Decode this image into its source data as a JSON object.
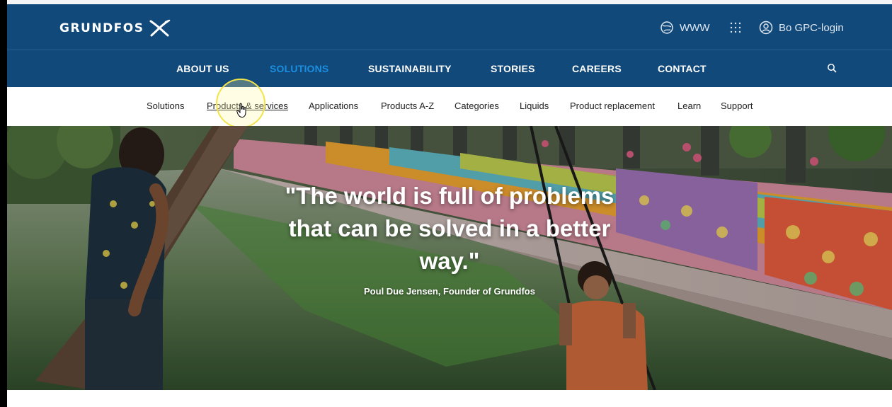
{
  "brand": {
    "name": "GRUNDFOS",
    "logo_icon": "grundfos-x-mark"
  },
  "utility": {
    "www_label": "WWW",
    "login_label": "Bo GPC-login",
    "icons": [
      "globe-icon",
      "apps-grid-icon",
      "user-icon"
    ]
  },
  "main_nav": {
    "items": [
      {
        "label": "ABOUT US"
      },
      {
        "label": "SOLUTIONS",
        "active": true
      },
      {
        "label": "SUSTAINABILITY"
      },
      {
        "label": "STORIES"
      },
      {
        "label": "CAREERS"
      },
      {
        "label": "CONTACT"
      }
    ],
    "search_icon": "search-icon"
  },
  "sub_nav": {
    "items": [
      {
        "label": "Solutions"
      },
      {
        "label": "Products & services",
        "hover": true
      },
      {
        "label": "Applications"
      },
      {
        "label": "Products A-Z"
      },
      {
        "label": "Categories"
      },
      {
        "label": "Liquids"
      },
      {
        "label": "Product replacement"
      },
      {
        "label": "Learn"
      },
      {
        "label": "Support"
      }
    ]
  },
  "hero": {
    "quote": "\"The world is full of problems that can be solved in a better way.\"",
    "author": "Poul Due Jensen, Founder of Grundfos"
  },
  "colors": {
    "header_bg": "#11497b",
    "active_nav": "#1a8fe0",
    "cursor_highlight": "#f2e34a"
  }
}
